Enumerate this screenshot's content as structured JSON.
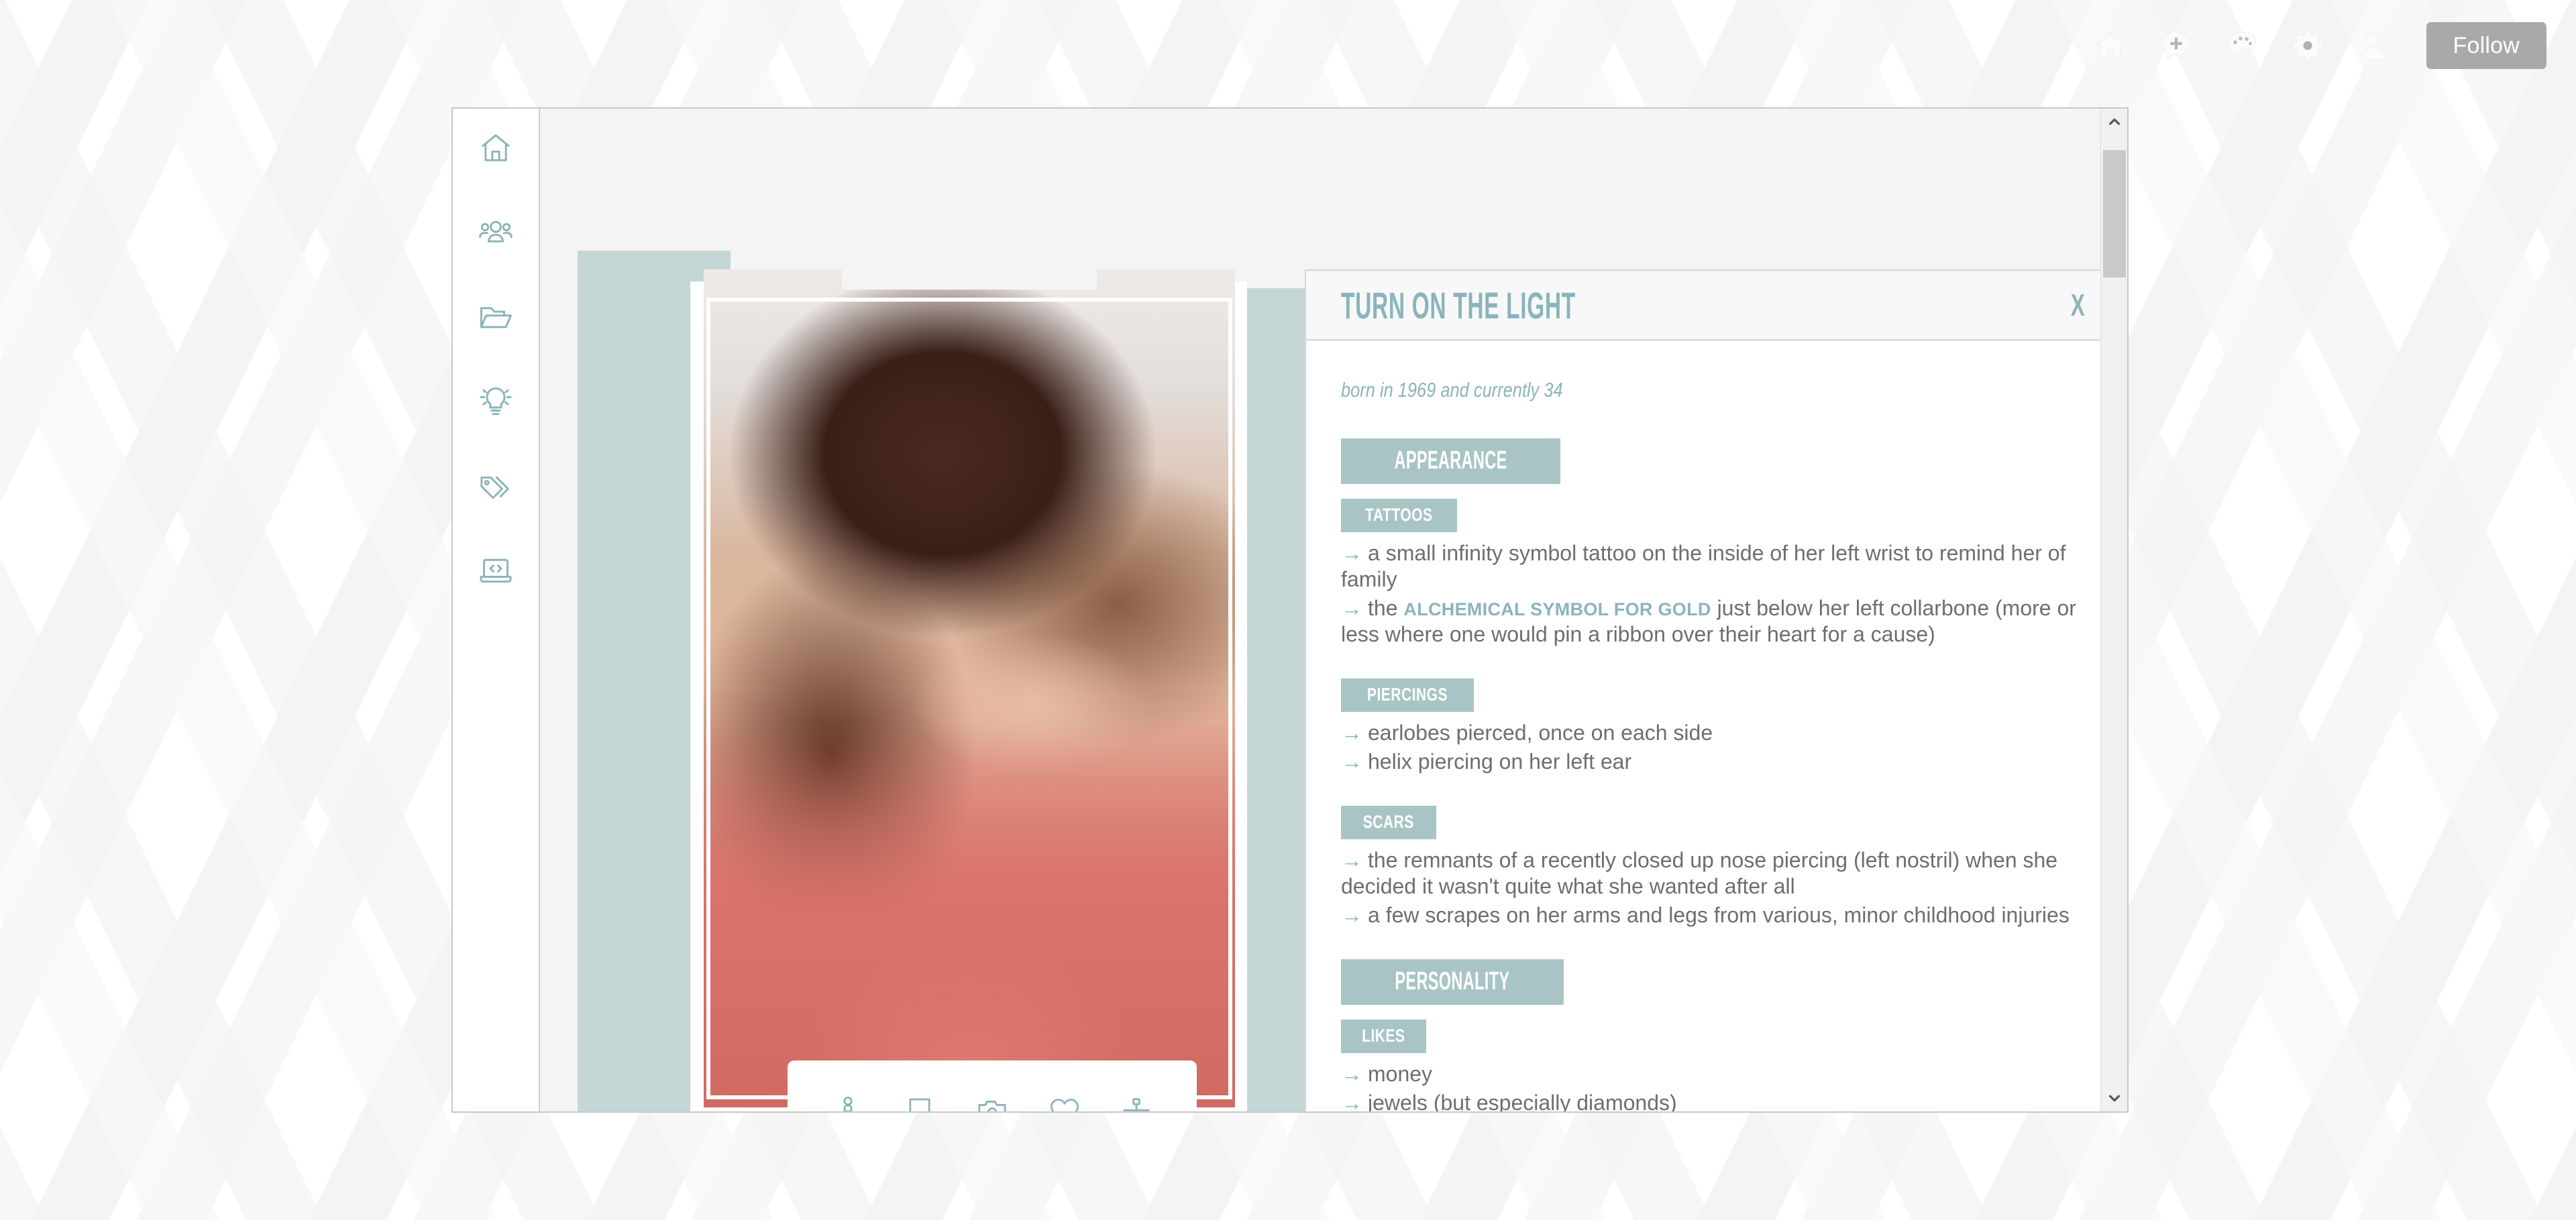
{
  "topbar": {
    "icons": [
      {
        "name": "home-icon",
        "label": "Home"
      },
      {
        "name": "add-post-icon",
        "label": "Add"
      },
      {
        "name": "palette-icon",
        "label": "Theme"
      },
      {
        "name": "gear-icon",
        "label": "Settings"
      },
      {
        "name": "user-icon",
        "label": "Account"
      }
    ],
    "follow_label": "Follow"
  },
  "sidebar": {
    "items": [
      {
        "icon": "home-icon",
        "label": "Home"
      },
      {
        "icon": "people-icon",
        "label": "Members"
      },
      {
        "icon": "folder-open-icon",
        "label": "Files"
      },
      {
        "icon": "lightbulb-icon",
        "label": "Ideas"
      },
      {
        "icon": "tags-icon",
        "label": "Tags"
      },
      {
        "icon": "laptop-code-icon",
        "label": "Code"
      }
    ]
  },
  "photo_actions": {
    "icons": [
      {
        "name": "profile-pin-icon",
        "label": "Profile"
      },
      {
        "name": "page-icon",
        "label": "Page"
      },
      {
        "name": "camera-icon",
        "label": "Gallery"
      },
      {
        "name": "heart-icon",
        "label": "Likes"
      },
      {
        "name": "sitemap-icon",
        "label": "Connections"
      }
    ]
  },
  "card": {
    "title": "TURN ON THE LIGHT",
    "close_label": "X",
    "subtitle": "born in 1969 and currently 34",
    "sections": [
      {
        "heading": "APPEARANCE",
        "groups": [
          {
            "label": "TATTOOS",
            "items": [
              {
                "pre": "a small infinity symbol tattoo on the inside of her left wrist to remind her of family",
                "link": "",
                "post": ""
              },
              {
                "pre": "the ",
                "link": "ALCHEMICAL SYMBOL FOR GOLD",
                "post": " just below her left collarbone (more or less where one would pin a ribbon over their heart for a cause)"
              }
            ]
          },
          {
            "label": "PIERCINGS",
            "items": [
              {
                "pre": "earlobes pierced, once on each side",
                "link": "",
                "post": ""
              },
              {
                "pre": "helix piercing on her left ear",
                "link": "",
                "post": ""
              }
            ]
          },
          {
            "label": "SCARS",
            "items": [
              {
                "pre": "the remnants of a recently closed up nose piercing (left nostril) when she decided it wasn't quite what she wanted after all",
                "link": "",
                "post": ""
              },
              {
                "pre": "a few scrapes on her arms and legs from various, minor childhood injuries",
                "link": "",
                "post": ""
              }
            ]
          }
        ]
      },
      {
        "heading": "PERSONALITY",
        "groups": [
          {
            "label": "LIKES",
            "items": [
              {
                "pre": "money",
                "link": "",
                "post": ""
              },
              {
                "pre": "jewels (but especially diamonds)",
                "link": "",
                "post": ""
              }
            ]
          }
        ]
      }
    ]
  },
  "colors": {
    "teal_accent": "#8ab4bb",
    "badge_bg": "#a9c4c5",
    "block_bg": "#c4d7d6",
    "body_text": "#6e6e6e",
    "follow_bg": "#a9a9a9"
  }
}
